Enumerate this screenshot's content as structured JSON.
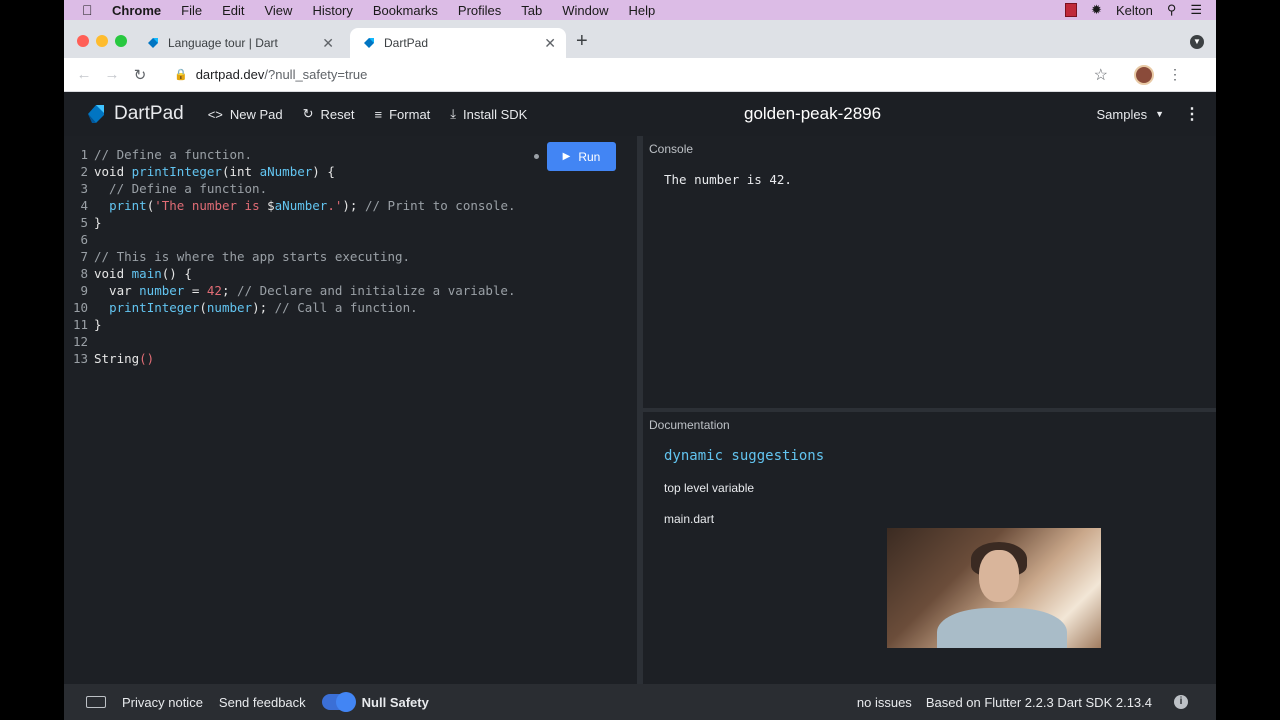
{
  "menubar": {
    "app": "Chrome",
    "items": [
      "File",
      "Edit",
      "View",
      "History",
      "Bookmarks",
      "Profiles",
      "Tab",
      "Window",
      "Help"
    ],
    "user": "Kelton"
  },
  "tabs": [
    {
      "title": "Language tour | Dart",
      "active": false
    },
    {
      "title": "DartPad",
      "active": true
    }
  ],
  "address": {
    "host": "dartpad.dev",
    "path": "/?null_safety=true"
  },
  "dartpad": {
    "logo": "DartPad",
    "buttons": {
      "new_pad": "New Pad",
      "reset": "Reset",
      "format": "Format",
      "install": "Install SDK"
    },
    "pad_name": "golden-peak-2896",
    "samples": "Samples",
    "run": "Run"
  },
  "code": {
    "line_numbers": [
      "1",
      "2",
      "3",
      "4",
      "5",
      "6",
      "7",
      "8",
      "9",
      "10",
      "11",
      "12",
      "13"
    ],
    "l1_comment": "// Define a function.",
    "l2_void": "void ",
    "l2_fn": "printInteger",
    "l2_open": "(int ",
    "l2_param": "aNumber",
    "l2_close": ") {",
    "l3_comment": "  // Define a function.",
    "l4_indent": "  ",
    "l4_fn": "print",
    "l4_paren": "(",
    "l4_str1": "'The number is ",
    "l4_interp": "$",
    "l4_var": "aNumber",
    "l4_str2": ".'",
    "l4_close": "); ",
    "l4_comment": "// Print to console.",
    "l5": "}",
    "l7_comment": "// This is where the app starts executing.",
    "l8_void": "void ",
    "l8_fn": "main",
    "l8_rest": "() {",
    "l9_var_kw": "  var ",
    "l9_var": "number",
    "l9_eq": " = ",
    "l9_num": "42",
    "l9_semi": "; ",
    "l9_comment": "// Declare and initialize a variable.",
    "l10_indent": "  ",
    "l10_fn": "printInteger",
    "l10_open": "(",
    "l10_arg": "number",
    "l10_close": "); ",
    "l10_comment": "// Call a function.",
    "l11": "}",
    "l13_type": "String",
    "l13_parens": "()"
  },
  "console": {
    "label": "Console",
    "output": "The number is 42."
  },
  "documentation": {
    "label": "Documentation",
    "title": "dynamic suggestions",
    "kind": "top level variable",
    "library": "main.dart"
  },
  "footer": {
    "privacy": "Privacy notice",
    "feedback": "Send feedback",
    "null_safety": "Null Safety",
    "issues": "no issues",
    "sdk": "Based on Flutter 2.2.3 Dart SDK 2.13.4"
  },
  "colors": {
    "accent": "#4285f4",
    "menubar": "#dcbce6",
    "editor_bg": "#1d2025",
    "function": "#62c4f0",
    "string": "#e06c75"
  }
}
